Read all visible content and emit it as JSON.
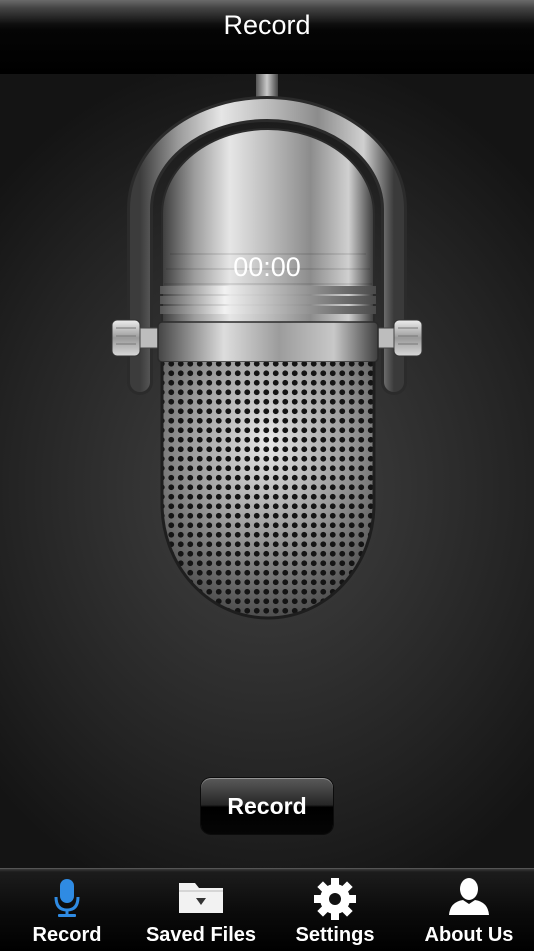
{
  "nav": {
    "title": "Record"
  },
  "recorder": {
    "elapsed_time": "00:00",
    "record_button_label": "Record"
  },
  "tabs": [
    {
      "label": "Record",
      "icon": "microphone-icon",
      "selected": true
    },
    {
      "label": "Saved Files",
      "icon": "folder-icon",
      "selected": false
    },
    {
      "label": "Settings",
      "icon": "gear-icon",
      "selected": false
    },
    {
      "label": "About Us",
      "icon": "person-icon",
      "selected": false
    }
  ],
  "colors": {
    "selected_tab": "#2f8be3",
    "unselected_tab": "#ffffff",
    "background": "#2a2a2a",
    "bar": "#000000"
  }
}
